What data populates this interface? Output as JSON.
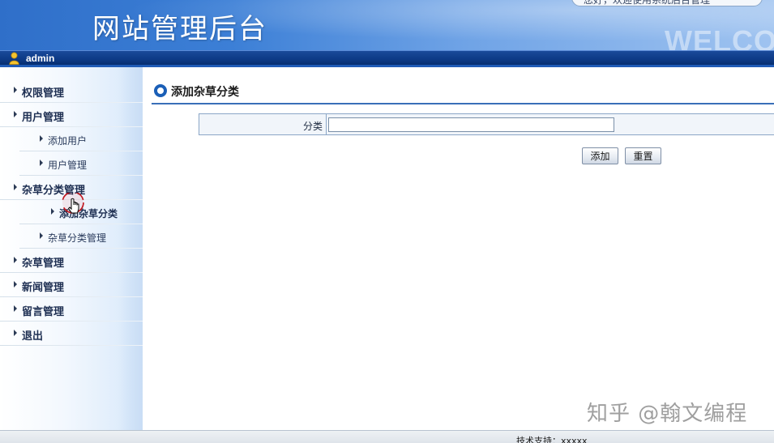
{
  "header": {
    "site_title": "网站管理后台",
    "welcome_text": "WELCOME",
    "notice_text": "您好，欢迎使用系统后台管理"
  },
  "userbar": {
    "user_name": "admin",
    "user_icon": "user-icon"
  },
  "sidebar": {
    "items": [
      {
        "label": "权限管理",
        "level": "top"
      },
      {
        "label": "用户管理",
        "level": "top"
      },
      {
        "label": "添加用户",
        "level": "sub"
      },
      {
        "label": "用户管理",
        "level": "sub"
      },
      {
        "label": "杂草分类管理",
        "level": "top"
      },
      {
        "label": "添加杂草分类",
        "level": "sub",
        "active": true
      },
      {
        "label": "杂草分类管理",
        "level": "sub"
      },
      {
        "label": "杂草管理",
        "level": "top"
      },
      {
        "label": "新闻管理",
        "level": "top"
      },
      {
        "label": "留言管理",
        "level": "top"
      },
      {
        "label": "退出",
        "level": "top"
      }
    ]
  },
  "main": {
    "title": "添加杂草分类",
    "form": {
      "category_label": "分类",
      "category_value": ""
    },
    "buttons": {
      "add": "添加",
      "reset": "重置"
    }
  },
  "footer": {
    "support_text": "技术支持：xxxxx"
  },
  "watermark": "知乎 @翰文编程",
  "colors": {
    "header_blue": "#2f6fc9",
    "userbar_navy": "#0d3a86",
    "accent_blue": "#1b5fb7"
  }
}
